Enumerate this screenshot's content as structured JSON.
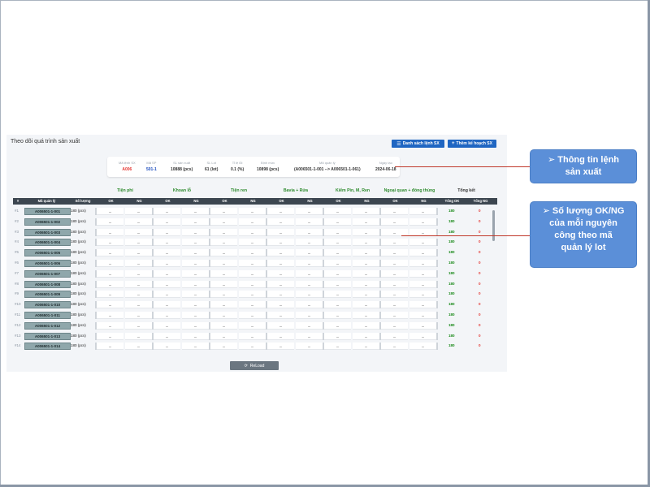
{
  "panel": {
    "title": "Theo dõi quá trình sản xuất"
  },
  "buttons": {
    "list": "Danh sách lệnh SX",
    "add": "Thêm kế hoạch SX",
    "reload": "ReLoad"
  },
  "info": [
    {
      "label": "Mã lệnh SX",
      "value": "A006",
      "color": "red"
    },
    {
      "label": "Mã SP",
      "value": "501-1",
      "color": "blue"
    },
    {
      "label": "SL sản xuất",
      "value": "10888 (pcs)"
    },
    {
      "label": "SL Lot",
      "value": "61 (lot)"
    },
    {
      "label": "Tỉ lệ lỗi",
      "value": "0.1 (%)"
    },
    {
      "label": "Định mức",
      "value": "10898 (pcs)"
    },
    {
      "label": "Mã quản lý",
      "value": "(A006501-1-001 --> A006501-1-061)"
    },
    {
      "label": "Ngày tạo",
      "value": "2024-06-18"
    }
  ],
  "stages": [
    "Tiện phi",
    "Khoan lỗ",
    "Tiện ren",
    "Bavia + Rửa",
    "Kiểm Pin, M, Ren",
    "Ngoại quan + đóng thùng"
  ],
  "summary_label": "Tổng kết",
  "headers": {
    "idx": "#",
    "code": "Mã quản lý",
    "qty": "Số lượng",
    "ok": "OK",
    "ng": "NG",
    "total_ok": "Tổng OK",
    "total_ng": "Tổng NG"
  },
  "empty_cell": "_",
  "rows": [
    {
      "idx": "#1",
      "code": "A006501-1-001",
      "qty": "180 (pcs)",
      "total_ok": "180",
      "total_ng": "0"
    },
    {
      "idx": "#2",
      "code": "A006501-1-002",
      "qty": "180 (pcs)",
      "total_ok": "180",
      "total_ng": "0"
    },
    {
      "idx": "#3",
      "code": "A006501-1-003",
      "qty": "180 (pcs)",
      "total_ok": "180",
      "total_ng": "0"
    },
    {
      "idx": "#4",
      "code": "A006501-1-004",
      "qty": "180 (pcs)",
      "total_ok": "180",
      "total_ng": "0"
    },
    {
      "idx": "#5",
      "code": "A006501-1-005",
      "qty": "180 (pcs)",
      "total_ok": "180",
      "total_ng": "0"
    },
    {
      "idx": "#6",
      "code": "A006501-1-006",
      "qty": "180 (pcs)",
      "total_ok": "180",
      "total_ng": "0"
    },
    {
      "idx": "#7",
      "code": "A006501-1-007",
      "qty": "180 (pcs)",
      "total_ok": "180",
      "total_ng": "0"
    },
    {
      "idx": "#8",
      "code": "A006501-1-008",
      "qty": "180 (pcs)",
      "total_ok": "180",
      "total_ng": "0"
    },
    {
      "idx": "#9",
      "code": "A006501-1-009",
      "qty": "180 (pcs)",
      "total_ok": "180",
      "total_ng": "0"
    },
    {
      "idx": "#10",
      "code": "A006501-1-010",
      "qty": "180 (pcs)",
      "total_ok": "180",
      "total_ng": "0"
    },
    {
      "idx": "#11",
      "code": "A006501-1-011",
      "qty": "180 (pcs)",
      "total_ok": "180",
      "total_ng": "0"
    },
    {
      "idx": "#12",
      "code": "A006501-1-012",
      "qty": "180 (pcs)",
      "total_ok": "180",
      "total_ng": "0"
    },
    {
      "idx": "#13",
      "code": "A006501-1-013",
      "qty": "180 (pcs)",
      "total_ok": "180",
      "total_ng": "0"
    },
    {
      "idx": "#14",
      "code": "A006501-1-014",
      "qty": "180 (pcs)",
      "total_ok": "180",
      "total_ng": "0"
    }
  ],
  "callouts": {
    "info": [
      "Thông tin lệnh",
      "sản xuất"
    ],
    "okng": [
      "Số lượng OK/NG",
      "của mỗi nguyên",
      "công theo mã",
      "quản lý lot"
    ]
  },
  "colors": {
    "accent": "#1f66c2",
    "header": "#3c4650",
    "callout": "#5b8fd8",
    "ok": "#1a8a1a",
    "ng": "#e53935"
  }
}
